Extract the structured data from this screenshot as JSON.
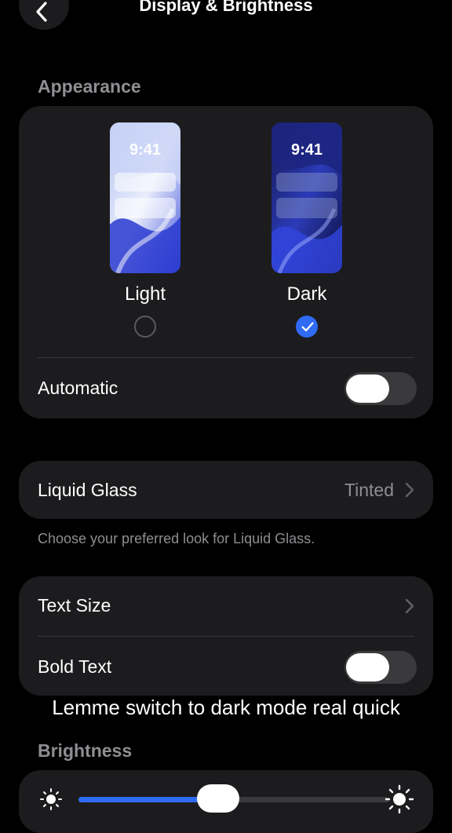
{
  "nav": {
    "title": "Display & Brightness",
    "back_icon": "chevron-left-icon"
  },
  "appearance": {
    "header": "Appearance",
    "options": [
      {
        "label": "Light",
        "time": "9:41",
        "selected": false
      },
      {
        "label": "Dark",
        "time": "9:41",
        "selected": true
      }
    ],
    "automatic": {
      "label": "Automatic",
      "on": false
    }
  },
  "liquid_glass": {
    "label": "Liquid Glass",
    "value": "Tinted",
    "footnote": "Choose your preferred look for Liquid Glass."
  },
  "text": {
    "text_size_label": "Text Size",
    "bold_text": {
      "label": "Bold Text",
      "on": false
    }
  },
  "caption": "Lemme switch to dark mode real quick",
  "brightness": {
    "header": "Brightness",
    "level": 0.45
  },
  "colors": {
    "accent": "#2f6bf5",
    "background": "#000000",
    "card": "#1c1c1e",
    "secondary_text": "#8e8e93"
  }
}
